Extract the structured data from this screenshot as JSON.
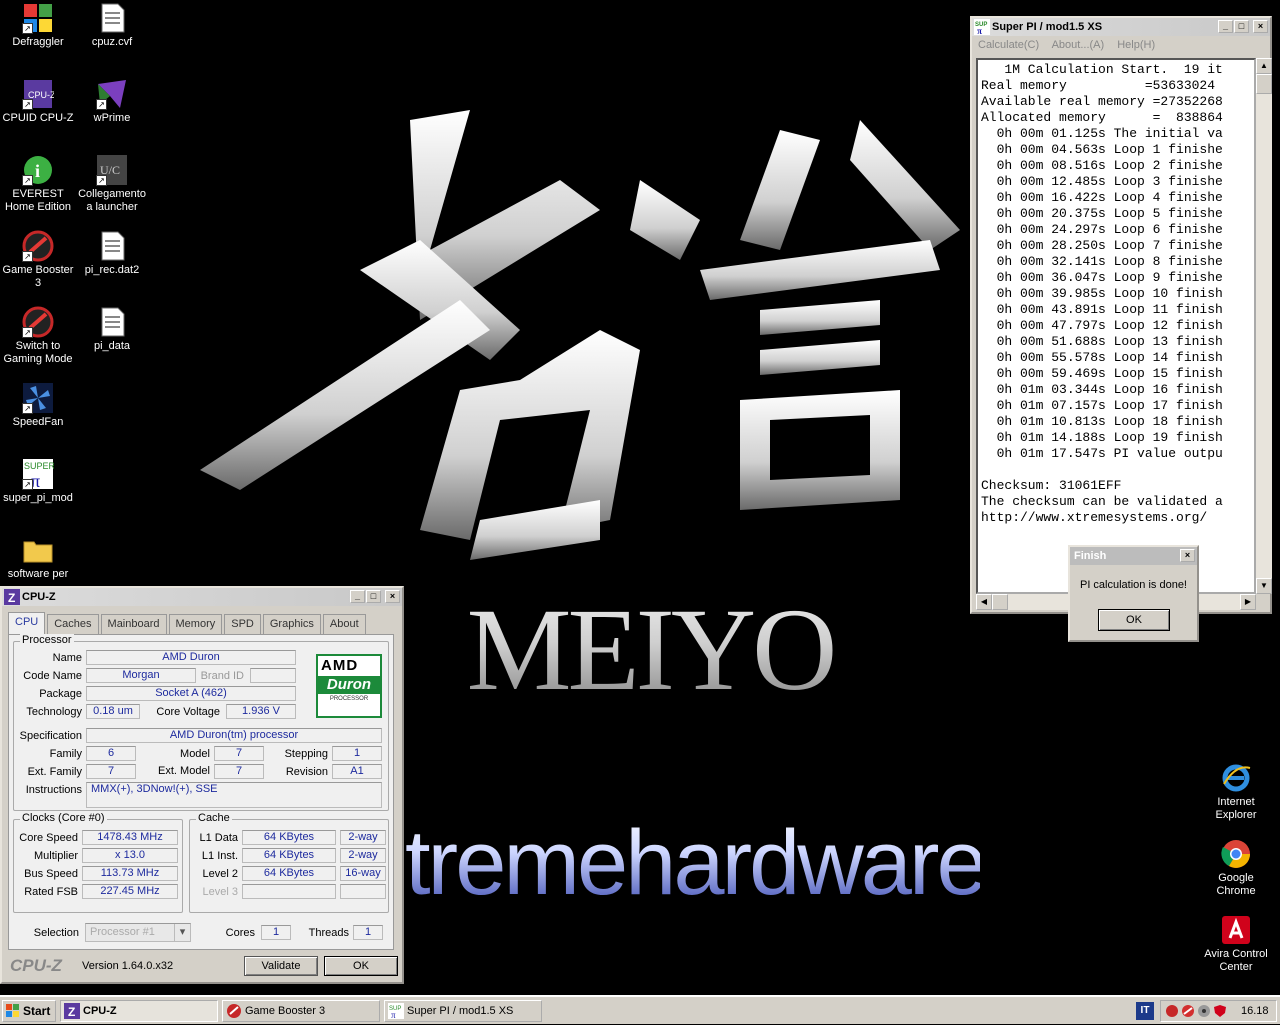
{
  "wallpaper": {
    "brand": "MEIYO",
    "logo_text": "tremehardware"
  },
  "desktop": {
    "icons_left": [
      {
        "label": "Defraggler",
        "icon": "defraggler-icon"
      },
      {
        "label": "cpuz.cvf",
        "icon": "document-icon"
      },
      {
        "label": "CPUID CPU-Z",
        "icon": "cpuz-icon"
      },
      {
        "label": "wPrime",
        "icon": "wprime-icon"
      },
      {
        "label": "EVEREST Home Edition",
        "icon": "info-icon"
      },
      {
        "label": "Collegamento a launcher",
        "icon": "launcher-icon"
      },
      {
        "label": "Game Booster 3",
        "icon": "game-booster-icon"
      },
      {
        "label": "pi_rec.dat2",
        "icon": "document-icon"
      },
      {
        "label": "Switch to Gaming Mode",
        "icon": "game-booster-icon"
      },
      {
        "label": "pi_data",
        "icon": "document-icon"
      },
      {
        "label": "SpeedFan",
        "icon": "fan-icon"
      },
      {
        "label": "super_pi_mod",
        "icon": "superpi-icon"
      },
      {
        "label": "software per",
        "icon": "folder-icon"
      }
    ],
    "icons_right": [
      {
        "label": "Internet Explorer",
        "icon": "ie-icon"
      },
      {
        "label": "Google Chrome",
        "icon": "chrome-icon"
      },
      {
        "label": "Avira Control Center",
        "icon": "avira-icon"
      }
    ]
  },
  "superpi": {
    "title": "Super PI / mod1.5 XS",
    "menu": [
      "Calculate(C)",
      "About...(A)",
      "Help(H)"
    ],
    "output_lines": [
      "   1M Calculation Start.  19 it",
      "Real memory          =53633024",
      "Available real memory =27352268",
      "Allocated memory      =  838864",
      "  0h 00m 01.125s The initial va",
      "  0h 00m 04.563s Loop 1 finishe",
      "  0h 00m 08.516s Loop 2 finishe",
      "  0h 00m 12.485s Loop 3 finishe",
      "  0h 00m 16.422s Loop 4 finishe",
      "  0h 00m 20.375s Loop 5 finishe",
      "  0h 00m 24.297s Loop 6 finishe",
      "  0h 00m 28.250s Loop 7 finishe",
      "  0h 00m 32.141s Loop 8 finishe",
      "  0h 00m 36.047s Loop 9 finishe",
      "  0h 00m 39.985s Loop 10 finish",
      "  0h 00m 43.891s Loop 11 finish",
      "  0h 00m 47.797s Loop 12 finish",
      "  0h 00m 51.688s Loop 13 finish",
      "  0h 00m 55.578s Loop 14 finish",
      "  0h 00m 59.469s Loop 15 finish",
      "  0h 01m 03.344s Loop 16 finish",
      "  0h 01m 07.157s Loop 17 finish",
      "  0h 01m 10.813s Loop 18 finish",
      "  0h 01m 14.188s Loop 19 finish",
      "  0h 01m 17.547s PI value outpu",
      "",
      "Checksum: 31061EFF",
      "The checksum can be validated a",
      "http://www.xtremesystems.org/"
    ]
  },
  "finish_dialog": {
    "title": "Finish",
    "message": "PI calculation is done!",
    "ok": "OK"
  },
  "cpuz": {
    "title": "CPU-Z",
    "tabs": [
      "CPU",
      "Caches",
      "Mainboard",
      "Memory",
      "SPD",
      "Graphics",
      "About"
    ],
    "active_tab": "CPU",
    "processor": {
      "group": "Processor",
      "name_label": "Name",
      "name": "AMD Duron",
      "codename_label": "Code Name",
      "codename": "Morgan",
      "brandid_label": "Brand ID",
      "brandid": "",
      "package_label": "Package",
      "package": "Socket A (462)",
      "technology_label": "Technology",
      "technology": "0.18 um",
      "voltage_label": "Core Voltage",
      "voltage": "1.936 V",
      "spec_label": "Specification",
      "spec": "AMD Duron(tm) processor",
      "family_label": "Family",
      "family": "6",
      "model_label": "Model",
      "model": "7",
      "stepping_label": "Stepping",
      "stepping": "1",
      "extfamily_label": "Ext. Family",
      "extfamily": "7",
      "extmodel_label": "Ext. Model",
      "extmodel": "7",
      "revision_label": "Revision",
      "revision": "A1",
      "instructions_label": "Instructions",
      "instructions": "MMX(+), 3DNow!(+), SSE",
      "logo_amd": "AMD",
      "logo_duron": "Duron",
      "logo_sub": "PROCESSOR"
    },
    "clocks": {
      "group": "Clocks (Core #0)",
      "corespeed_label": "Core Speed",
      "corespeed": "1478.43 MHz",
      "multiplier_label": "Multiplier",
      "multiplier": "x 13.0",
      "busspeed_label": "Bus Speed",
      "busspeed": "113.73 MHz",
      "fsb_label": "Rated FSB",
      "fsb": "227.45 MHz"
    },
    "cache": {
      "group": "Cache",
      "l1d_label": "L1 Data",
      "l1d": "64 KBytes",
      "l1d_way": "2-way",
      "l1i_label": "L1 Inst.",
      "l1i": "64 KBytes",
      "l1i_way": "2-way",
      "l2_label": "Level 2",
      "l2": "64 KBytes",
      "l2_way": "16-way",
      "l3_label": "Level 3"
    },
    "selection_label": "Selection",
    "selection": "Processor #1",
    "cores_label": "Cores",
    "cores": "1",
    "threads_label": "Threads",
    "threads": "1",
    "brand": "CPU-Z",
    "version": "Version 1.64.0.x32",
    "validate": "Validate",
    "ok": "OK"
  },
  "taskbar": {
    "start": "Start",
    "tasks": [
      "CPU-Z",
      "Game Booster 3",
      "Super PI / mod1.5 XS"
    ],
    "lang": "IT",
    "clock": "16.18"
  }
}
